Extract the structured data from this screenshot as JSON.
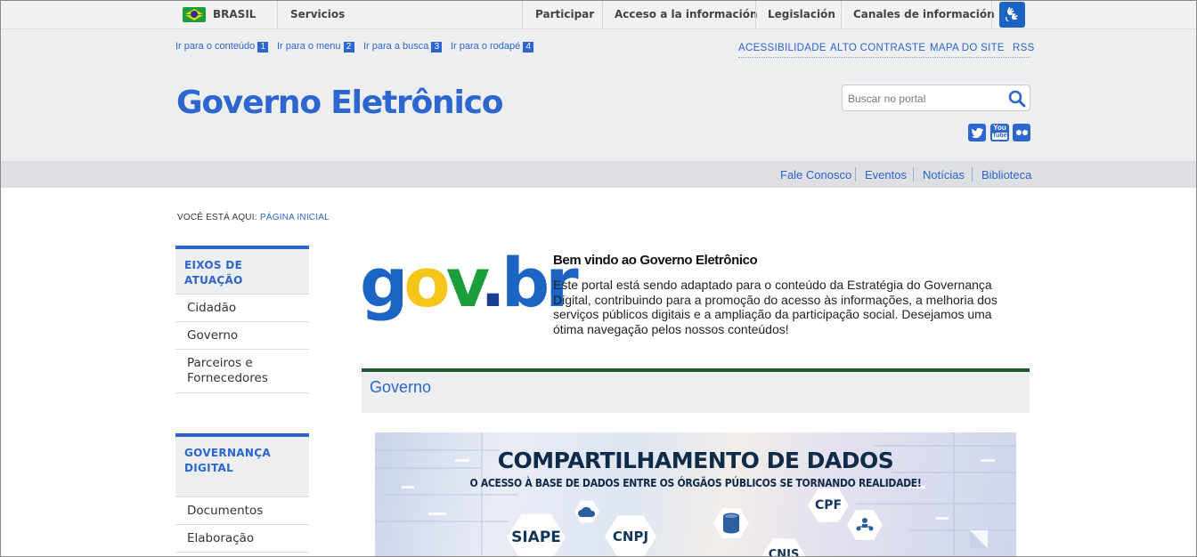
{
  "govbar": {
    "country": "BRASIL",
    "services": "Servicios",
    "links": [
      "Participar",
      "Acceso a la información",
      "Legislación",
      "Canales de información"
    ],
    "accessibility_icon": "sign-language-icon"
  },
  "header": {
    "skip_links": [
      {
        "label": "Ir para o conteúdo",
        "key": "1"
      },
      {
        "label": "Ir para o menu",
        "key": "2"
      },
      {
        "label": "Ir para a busca",
        "key": "3"
      },
      {
        "label": "Ir para o rodapé",
        "key": "4"
      }
    ],
    "top_links": [
      "ACESSIBILIDADE",
      "ALTO CONTRASTE",
      "MAPA DO SITE",
      "RSS"
    ],
    "site_title": "Governo Eletrônico",
    "search_placeholder": "Buscar no portal",
    "social": [
      {
        "name": "twitter",
        "icon": "twitter-icon"
      },
      {
        "name": "youtube",
        "icon": "youtube-icon",
        "label_top": "You",
        "label_bottom": "Tube"
      },
      {
        "name": "flickr",
        "icon": "flickr-icon"
      }
    ]
  },
  "nav": {
    "links": [
      "Fale Conosco",
      "Eventos",
      "Notícias",
      "Biblioteca"
    ]
  },
  "breadcrumb": {
    "prefix": "VOCÊ ESTÁ AQUI:",
    "current": "PÁGINA INICIAL"
  },
  "sidebar": {
    "sections": [
      {
        "title": "EIXOS DE ATUAÇÃO",
        "items": [
          "Cidadão",
          "Governo",
          "Parceiros e Fornecedores"
        ]
      },
      {
        "title_line1": "GOVERNANÇA",
        "title_line2": "DIGITAL",
        "items": [
          "Documentos",
          "Elaboração"
        ]
      }
    ]
  },
  "main": {
    "logo": {
      "g": "g",
      "o": "o",
      "v": "v",
      "dot": ".",
      "br": "br"
    },
    "welcome_title": "Bem vindo ao Governo Eletrônico",
    "welcome_text": "Este portal está sendo adaptado para o conteúdo da Estratégia do Governança Digital, contribuindo para a promoção do acesso às informações, a melhoria dos serviços públicos digitais e a ampliação da participação social. Desejamos uma ótima navegação pelos nossos conteúdos!",
    "section_title": "Governo",
    "banner": {
      "title": "COMPARTILHAMENTO DE DADOS",
      "subtitle": "O ACESSO À BASE DE DADOS ENTRE OS ÓRGÃOS PÚBLICOS SE TORNANDO REALIDADE!",
      "hex_labels": [
        "SIAPE",
        "CNPJ",
        "CPF",
        "CNIS"
      ]
    }
  },
  "colors": {
    "brand_blue": "#2c66ce",
    "logo_green": "#1b9f3a",
    "logo_yellow": "#f5c518",
    "logo_blue": "#1c3d8f",
    "section_rule": "#1e5a2a"
  }
}
